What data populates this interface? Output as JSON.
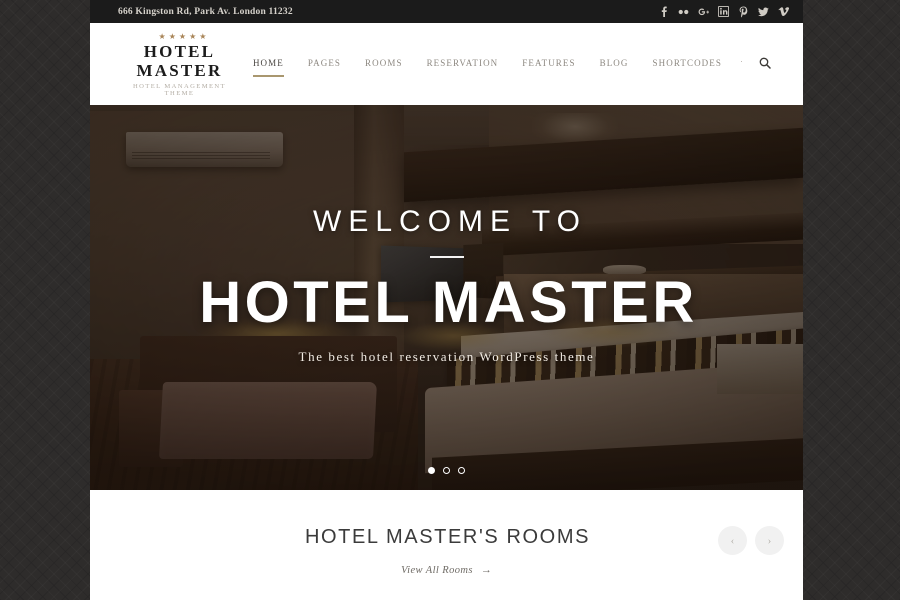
{
  "topbar": {
    "address": "666 Kingston Rd, Park Av. London 11232",
    "social": [
      {
        "name": "facebook-icon",
        "glyph": "f"
      },
      {
        "name": "flickr-icon",
        "glyph": "••"
      },
      {
        "name": "google-plus-icon",
        "glyph": "g+"
      },
      {
        "name": "linkedin-icon",
        "glyph": "in"
      },
      {
        "name": "pinterest-icon",
        "glyph": "P"
      },
      {
        "name": "twitter-icon",
        "glyph": "t"
      },
      {
        "name": "vimeo-icon",
        "glyph": "v"
      }
    ]
  },
  "header": {
    "logo": {
      "stars": "★★★★★",
      "star_count": 5,
      "title": "HOTEL MASTER",
      "subtitle": "HOTEL MANAGEMENT THEME",
      "star_color": "#a98558"
    },
    "nav": [
      {
        "label": "HOME",
        "active": true
      },
      {
        "label": "PAGES",
        "active": false
      },
      {
        "label": "ROOMS",
        "active": false
      },
      {
        "label": "RESERVATION",
        "active": false
      },
      {
        "label": "FEATURES",
        "active": false
      },
      {
        "label": "BLOG",
        "active": false
      },
      {
        "label": "SHORTCODES",
        "active": false
      }
    ],
    "nav_separator": "·",
    "search_icon": "search-icon",
    "active_underline_color": "#a9976f"
  },
  "hero": {
    "welcome": "WELCOME TO",
    "title": "HOTEL MASTER",
    "tagline": "The best hotel reservation WordPress theme",
    "slides": [
      {
        "active": true
      },
      {
        "active": false
      },
      {
        "active": false
      }
    ],
    "image_description": "Hotel room interior with bed, armchair, TV and wall air conditioner"
  },
  "rooms": {
    "title": "HOTEL MASTER'S ROOMS",
    "link_text": "View All Rooms",
    "link_arrow": "→",
    "prev_arrow": "‹",
    "next_arrow": "›"
  }
}
